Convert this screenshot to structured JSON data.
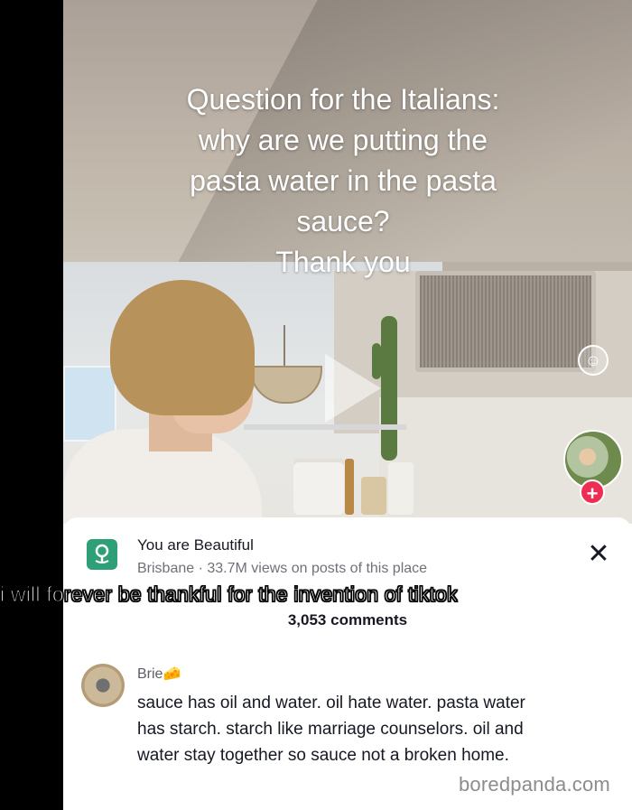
{
  "video": {
    "question_lines": [
      "Question for the Italians:",
      "why are we putting the",
      "pasta water in the pasta",
      "sauce?",
      "Thank you"
    ],
    "shirt_print": "⭒̵‹/"
  },
  "sidebar": {
    "follow_symbol": "+",
    "reaction_symbol": "☺"
  },
  "place": {
    "name": "You are Beautiful",
    "subtitle": "Brisbane · 33.7M views on posts of this place",
    "icon": "location-pin-icon"
  },
  "overlay_caption": "i will forever be thankful for the invention of tiktok",
  "comments": {
    "count_label": "3,053 comments",
    "items": [
      {
        "author": "Brie🧀",
        "text_lines": [
          "sauce has oil and water. oil hate water. pasta water",
          "has starch. starch like marriage counselors. oil and",
          "water stay together so sauce not a broken home."
        ]
      }
    ]
  },
  "close_symbol": "✕",
  "credit": "boredpanda.com",
  "colors": {
    "follow_red": "#ef2c54",
    "place_green": "#2f9f78"
  }
}
